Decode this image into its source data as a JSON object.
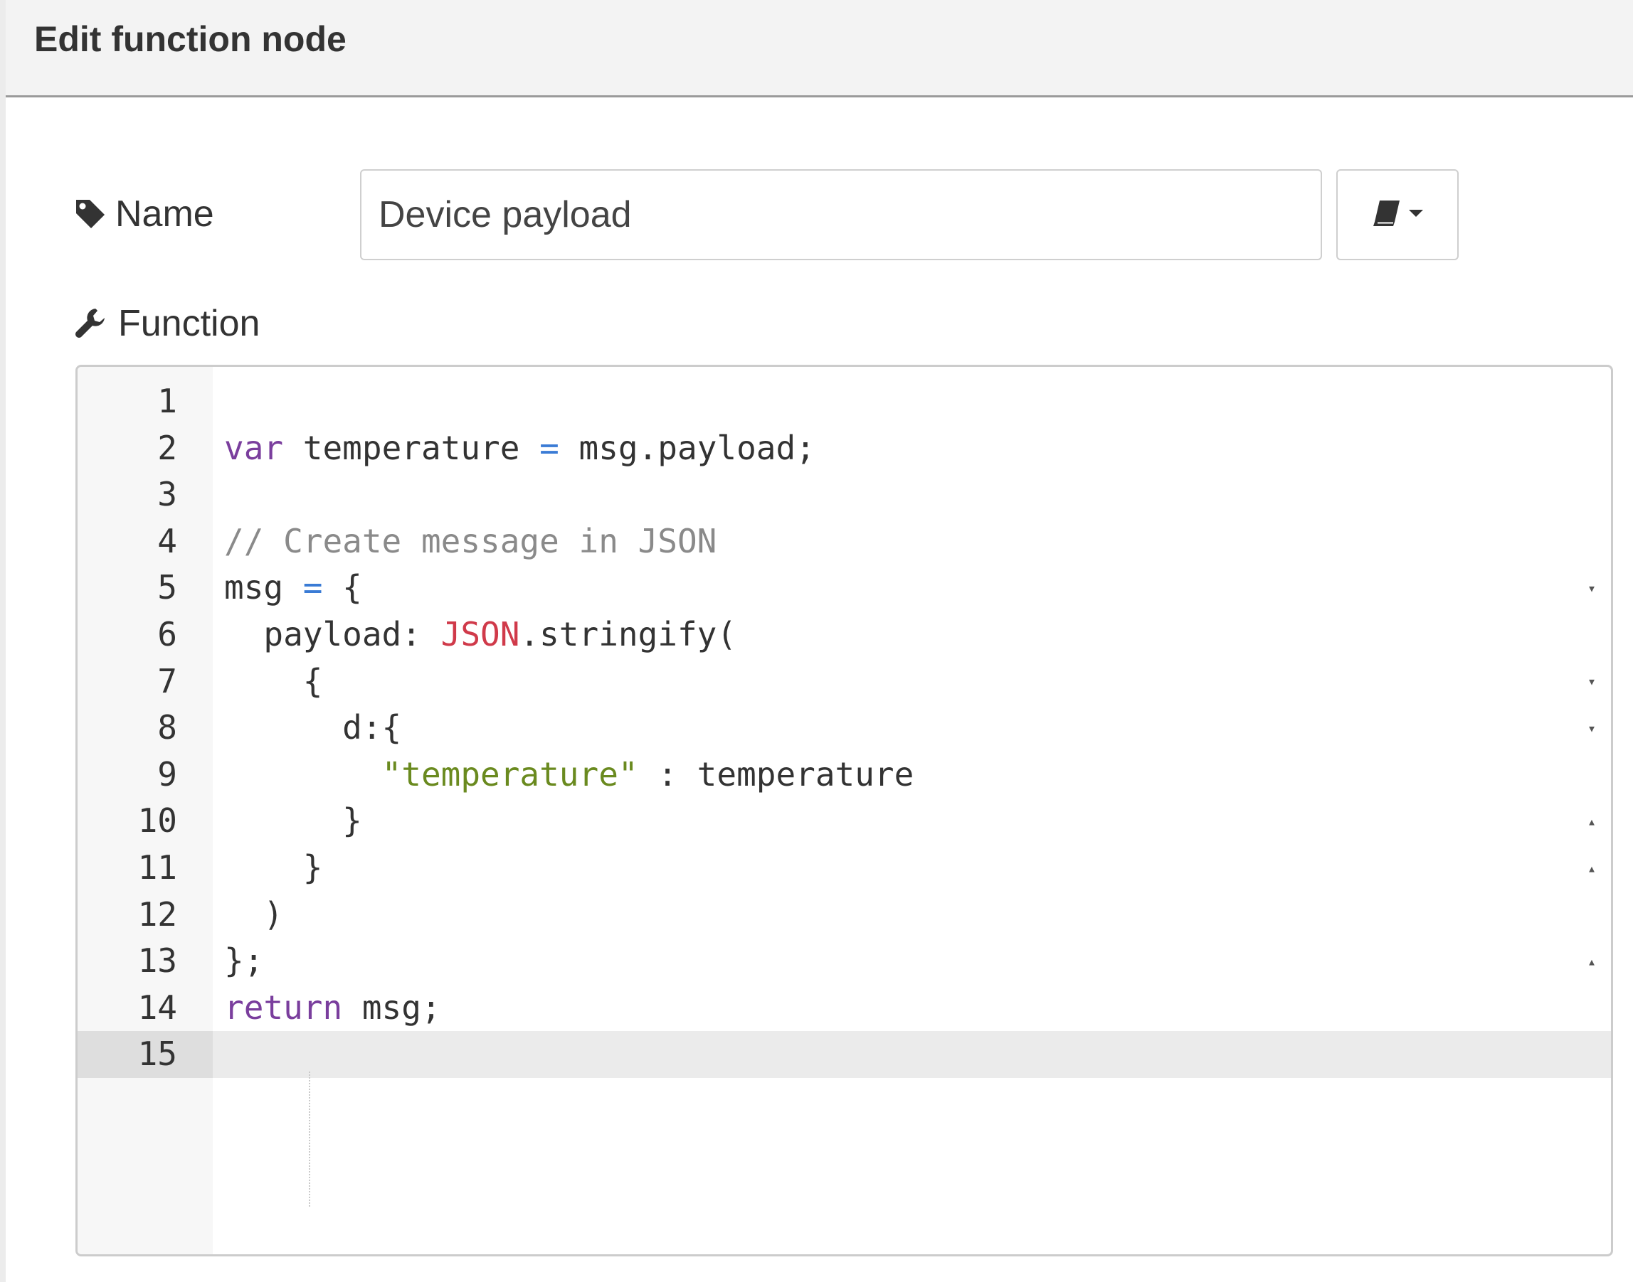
{
  "dialog": {
    "title": "Edit function node"
  },
  "name_field": {
    "label": "Name",
    "value": "Device payload",
    "icon": "tag-icon"
  },
  "library_button": {
    "icon": "book-icon",
    "caret": "caret-down-icon"
  },
  "function_field": {
    "label": "Function",
    "icon": "wrench-icon"
  },
  "editor": {
    "active_line": 15,
    "lines": [
      {
        "num": "1",
        "fold": "",
        "tokens": []
      },
      {
        "num": "2",
        "fold": "",
        "tokens": [
          [
            "kw",
            "var"
          ],
          [
            "t",
            " temperature "
          ],
          [
            "op",
            "="
          ],
          [
            "t",
            " msg.payload;"
          ]
        ]
      },
      {
        "num": "3",
        "fold": "",
        "tokens": []
      },
      {
        "num": "4",
        "fold": "",
        "tokens": [
          [
            "cm",
            "// Create message in JSON"
          ]
        ]
      },
      {
        "num": "5",
        "fold": "down",
        "tokens": [
          [
            "t",
            "msg "
          ],
          [
            "op",
            "="
          ],
          [
            "t",
            " {"
          ]
        ]
      },
      {
        "num": "6",
        "fold": "",
        "tokens": [
          [
            "t",
            "  payload: "
          ],
          [
            "bi",
            "JSON"
          ],
          [
            "t",
            ".stringify("
          ]
        ]
      },
      {
        "num": "7",
        "fold": "down",
        "tokens": [
          [
            "t",
            "    {"
          ]
        ]
      },
      {
        "num": "8",
        "fold": "down",
        "tokens": [
          [
            "t",
            "      d:{"
          ]
        ]
      },
      {
        "num": "9",
        "fold": "",
        "tokens": [
          [
            "t",
            "        "
          ],
          [
            "str",
            "\"temperature\""
          ],
          [
            "t",
            " : temperature"
          ]
        ]
      },
      {
        "num": "10",
        "fold": "up",
        "tokens": [
          [
            "t",
            "      }"
          ]
        ]
      },
      {
        "num": "11",
        "fold": "up",
        "tokens": [
          [
            "t",
            "    }"
          ]
        ]
      },
      {
        "num": "12",
        "fold": "",
        "tokens": [
          [
            "t",
            "  )"
          ]
        ]
      },
      {
        "num": "13",
        "fold": "up",
        "tokens": [
          [
            "t",
            "};"
          ]
        ]
      },
      {
        "num": "14",
        "fold": "",
        "tokens": [
          [
            "kw",
            "return"
          ],
          [
            "t",
            " msg;"
          ]
        ]
      },
      {
        "num": "15",
        "fold": "",
        "tokens": []
      }
    ]
  },
  "colors": {
    "keyword": "#7a3e9d",
    "operator": "#3a7bd5",
    "comment": "#8a8a8a",
    "string": "#6a8a1f",
    "builtin": "#d03a4a"
  }
}
